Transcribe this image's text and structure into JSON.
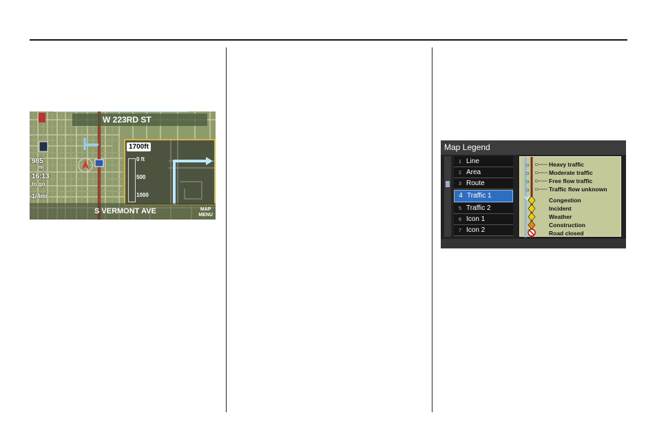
{
  "nav_screen": {
    "street_top": "W 223RD ST",
    "street_bottom": "S VERMONT AVE",
    "map_menu_line1": "MAP",
    "map_menu_line2": "MENU",
    "distance_value": "985",
    "distance_unit": "mi",
    "time_value": "16:13",
    "time_label": "to go",
    "scale": "1/4mi",
    "next_turn_distance": "1700ft",
    "guide_ticks": [
      "0 ft",
      "500",
      "1000"
    ]
  },
  "legend_screen": {
    "title": "Map Legend",
    "items": [
      {
        "num": "1",
        "label": "Line"
      },
      {
        "num": "2",
        "label": "Area"
      },
      {
        "num": "3",
        "label": "Route"
      },
      {
        "num": "4",
        "label": "Traffic 1"
      },
      {
        "num": "5",
        "label": "Traffic 2"
      },
      {
        "num": "6",
        "label": "Icon 1"
      },
      {
        "num": "7",
        "label": "Icon 2"
      }
    ],
    "selected_index": 3,
    "flow_entries": [
      "Heavy traffic",
      "Moderate traffic",
      "Free flow traffic",
      "Traffic flow unknown"
    ],
    "incident_entries": [
      "Congestion",
      "Incident",
      "Weather",
      "Construction",
      "Road closed"
    ]
  }
}
